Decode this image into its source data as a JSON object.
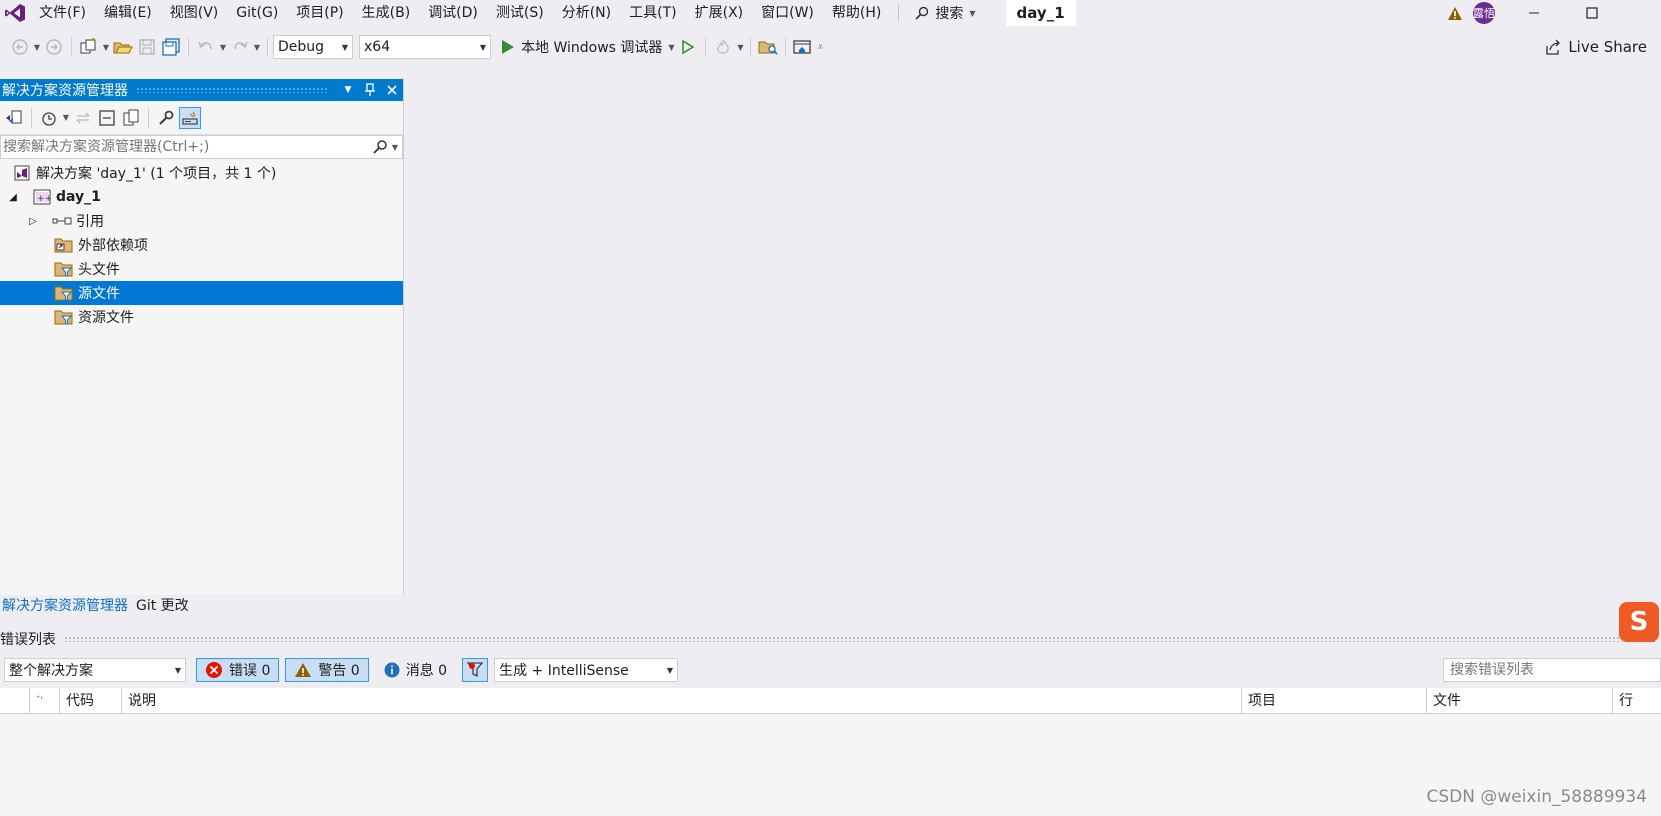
{
  "menu": [
    "文件(F)",
    "编辑(E)",
    "视图(V)",
    "Git(G)",
    "项目(P)",
    "生成(B)",
    "调试(D)",
    "测试(S)",
    "分析(N)",
    "工具(T)",
    "扩展(X)",
    "窗口(W)",
    "帮助(H)"
  ],
  "search_label": "搜索",
  "solution_title": "day_1",
  "avatar_text": "露悟",
  "toolbar": {
    "config": "Debug",
    "platform": "x64",
    "run_label": "本地 Windows 调试器",
    "live_share": "Live Share"
  },
  "explorer": {
    "title": "解决方案资源管理器",
    "search_placeholder": "搜索解决方案资源管理器(Ctrl+;)",
    "tree": {
      "solution": "解决方案 'day_1' (1 个项目，共 1 个)",
      "project": "day_1",
      "references": "引用",
      "external_deps": "外部依赖项",
      "header_files": "头文件",
      "source_files": "源文件",
      "resource_files": "资源文件"
    },
    "tabs": [
      "解决方案资源管理器",
      "Git 更改"
    ]
  },
  "error_list": {
    "title": "错误列表",
    "scope": "整个解决方案",
    "errors": "错误 0",
    "warnings": "警告 0",
    "messages": "消息 0",
    "build_filter": "生成 + IntelliSense",
    "search_placeholder": "搜索错误列表",
    "columns": [
      "代码",
      "说明",
      "项目",
      "文件",
      "行"
    ]
  },
  "watermark": "CSDN @weixin_58889934",
  "colors": {
    "accent": "#007acc",
    "selected": "#0078d4",
    "vs_purple": "#68217a"
  }
}
